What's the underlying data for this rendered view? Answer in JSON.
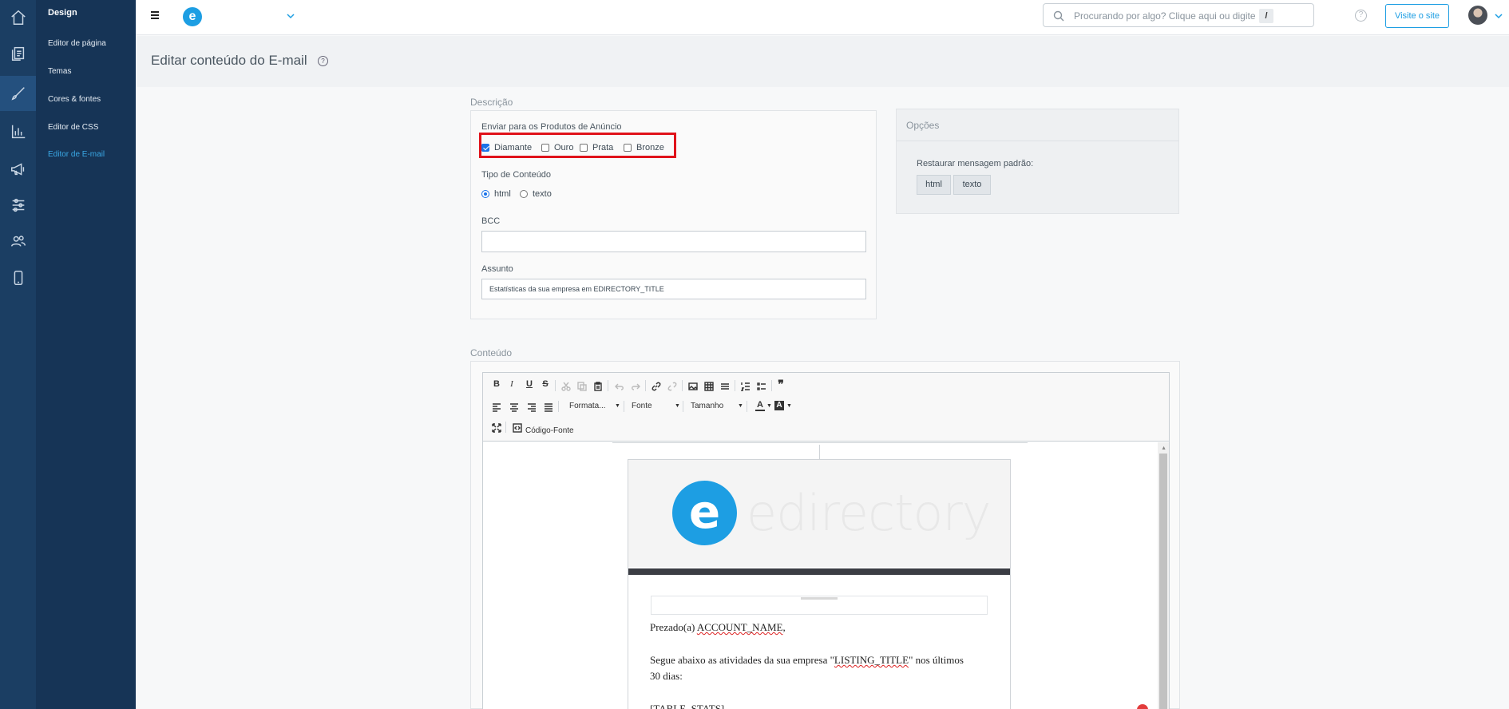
{
  "subnav": {
    "header": "Design",
    "items": [
      "Editor de página",
      "Temas",
      "Cores & fontes",
      "Editor de CSS",
      "Editor de E-mail"
    ]
  },
  "topbar": {
    "logo_letter": "e",
    "search_placeholder": "Procurando por algo? Clique aqui ou digite",
    "search_shortcut": "/",
    "help": "?",
    "visit_label": "Visite o site"
  },
  "page": {
    "title": "Editar conteúdo do E-mail",
    "help": "?"
  },
  "description": {
    "section_label": "Descrição",
    "send_label": "Enviar para os Produtos de Anúncio",
    "levels": [
      {
        "label": "Diamante",
        "checked": true
      },
      {
        "label": "Ouro",
        "checked": false
      },
      {
        "label": "Prata",
        "checked": false
      },
      {
        "label": "Bronze",
        "checked": false
      }
    ],
    "content_type_label": "Tipo de Conteúdo",
    "content_types": [
      {
        "label": "html",
        "checked": true
      },
      {
        "label": "texto",
        "checked": false
      }
    ],
    "bcc_label": "BCC",
    "bcc_value": "",
    "subject_label": "Assunto",
    "subject_value": "Estatísticas da sua empresa em EDIRECTORY_TITLE"
  },
  "options": {
    "title": "Opções",
    "restore_label": "Restaurar mensagem padrão:",
    "buttons": [
      "html",
      "texto"
    ]
  },
  "content": {
    "section_label": "Conteúdo",
    "toolbar": {
      "bold": "B",
      "italic": "I",
      "underline": "U",
      "strike": "S",
      "quote": "❞",
      "format": "Formata...",
      "font": "Fonte",
      "size": "Tamanho",
      "font_color": "A",
      "bg_color": "A",
      "source": "Código-Fonte"
    },
    "email": {
      "brand_letter": "e",
      "brand_word": "edirectory",
      "greeting_prefix": "Prezado(a) ",
      "greeting_var": "ACCOUNT_NAME",
      "greeting_suffix": ",",
      "line1_prefix": "Segue abaixo as atividades da sua empresa \"",
      "line1_var": "LISTING_TITLE",
      "line1_suffix": "\" nos últimos",
      "line2": "30 dias:",
      "line3": "[TABLE_STATS]"
    }
  }
}
